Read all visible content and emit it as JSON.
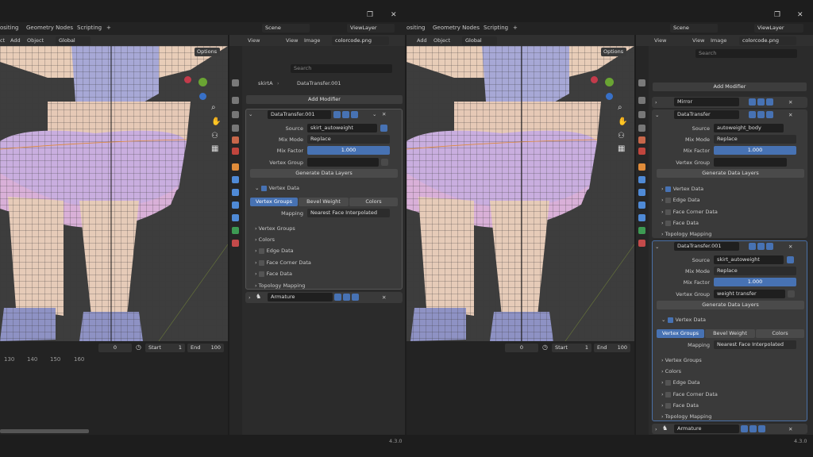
{
  "tabs_left": [
    "ositing",
    "Geometry Nodes",
    "Scripting",
    "+"
  ],
  "tabs_right": [
    "ositing",
    "Geometry Nodes",
    "Scripting",
    "+"
  ],
  "scene_label": "Scene",
  "viewlayer_label": "ViewLayer",
  "vp_menu": [
    "ct",
    "Add",
    "Object"
  ],
  "vp_menu_r": [
    "Add",
    "Object"
  ],
  "global_label": "Global",
  "options_label": "Options",
  "img_menu": [
    "View",
    "View",
    "Image"
  ],
  "img_file": "colorcode.png",
  "search_placeholder": "Search",
  "breadcrumb": {
    "object": "skirtA",
    "modifier": "DataTransfer.001"
  },
  "add_modifier": "Add Modifier",
  "left_panel": {
    "mod_name": "DataTransfer.001",
    "source_label": "Source",
    "source_value": "skirt_autoweight",
    "mixmode_label": "Mix Mode",
    "mixmode_value": "Replace",
    "mixfactor_label": "Mix Factor",
    "mixfactor_value": "1.000",
    "vgroup_label": "Vertex Group",
    "vgroup_value": "",
    "gen_label": "Generate Data Layers",
    "vertex_data": "Vertex Data",
    "seg": [
      "Vertex Groups",
      "Bevel Weight",
      "Colors"
    ],
    "mapping_label": "Mapping",
    "mapping_value": "Nearest Face Interpolated",
    "sub": [
      "Vertex Groups",
      "Colors",
      "Edge Data",
      "Face Corner Data",
      "Face Data",
      "Topology Mapping"
    ],
    "armature": "Armature"
  },
  "right_panel": {
    "mirror": "Mirror",
    "dt1": {
      "name": "DataTransfer",
      "source_value": "autoweight_body",
      "mixmode_value": "Replace",
      "mixfactor_value": "1.000",
      "vgroup_value": ""
    },
    "dt1_sub": [
      "Vertex Data",
      "Edge Data",
      "Face Corner Data",
      "Face Data",
      "Topology Mapping"
    ],
    "dt2": {
      "name": "DataTransfer.001",
      "source_value": "skirt_autoweight",
      "mixmode_value": "Replace",
      "mixfactor_value": "1.000",
      "vgroup_value": "weight transfer"
    },
    "labels": {
      "source": "Source",
      "mixmode": "Mix Mode",
      "mixfactor": "Mix Factor",
      "vgroup": "Vertex Group",
      "gen": "Generate Data Layers",
      "vertex_data": "Vertex Data",
      "mapping": "Mapping"
    },
    "seg": [
      "Vertex Groups",
      "Bevel Weight",
      "Colors"
    ],
    "mapping_value": "Nearest Face Interpolated",
    "sub": [
      "Vertex Groups",
      "Colors",
      "Edge Data",
      "Face Corner Data",
      "Face Data",
      "Topology Mapping"
    ],
    "armature": "Armature"
  },
  "timeline": {
    "frame": "0",
    "start_label": "Start",
    "start": "1",
    "end_label": "End",
    "end": "100",
    "ticks": [
      "130",
      "140",
      "150",
      "160"
    ]
  },
  "version": "4.3.0",
  "colors": {
    "accent": "#4772b3",
    "panel": "#303030",
    "viewport": "#3d3d3d",
    "modifier_bg": "#3a3a3a"
  }
}
